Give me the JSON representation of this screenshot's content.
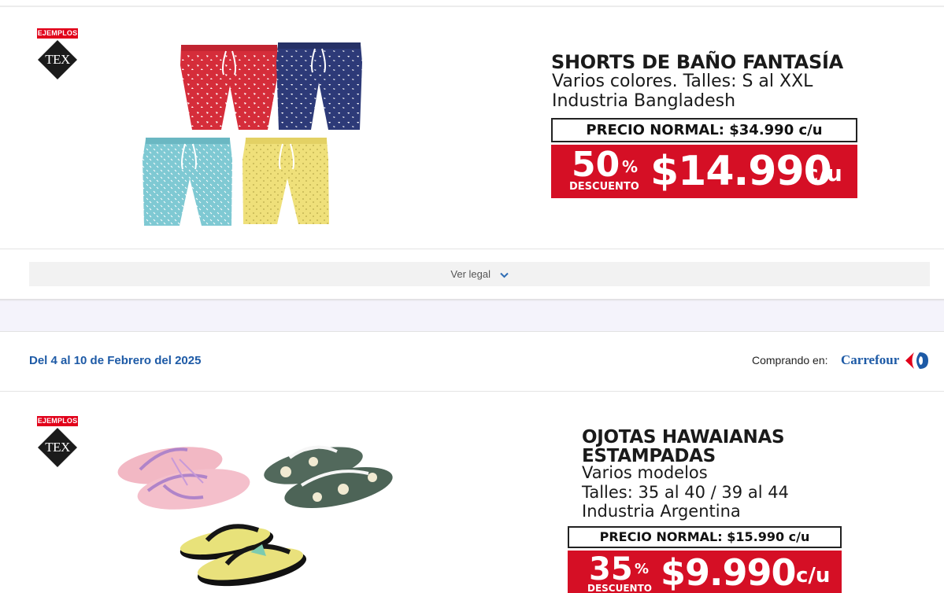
{
  "products": [
    {
      "badge_top": "EJEMPLOS",
      "badge_brand": "TEX",
      "title_line1": "SHORTS DE BAÑO FANTASÍA",
      "sub_line1": "Varios colores. Talles: S al XXL",
      "sub_line2": "Industria Bangladesh",
      "normal_price": "PRECIO NORMAL: $34.990 c/u",
      "discount_number": "50",
      "discount_sign": "%",
      "discount_word": "DESCUENTO",
      "price": "$14.990",
      "unit": "c/u"
    },
    {
      "badge_top": "EJEMPLOS",
      "badge_brand": "TEX",
      "title_line1": "OJOTAS HAWAIANAS",
      "title_line2": "ESTAMPADAS",
      "sub_line1": "Varios modelos",
      "sub_line2": "Talles: 35 al 40 / 39 al 44",
      "sub_line3": "Industria Argentina",
      "normal_price": "PRECIO NORMAL: $15.990 c/u",
      "discount_number": "35",
      "discount_sign": "%",
      "discount_word": "DESCUENTO",
      "price": "$9.990",
      "unit": "c/u"
    }
  ],
  "legal": {
    "label": "Ver legal",
    "icon": "chevron-down-icon"
  },
  "catalog_header": {
    "dates": "Del 4 al 10 de Febrero del 2025",
    "buying_label": "Comprando en:",
    "store_name": "Carrefour",
    "store_logo_icon": "carrefour-logo-icon"
  },
  "colors": {
    "price_red": "#d50f25",
    "badge_red": "#e1001a",
    "link_blue": "#1d5aa6",
    "gap_bg": "#f4f3fb"
  }
}
